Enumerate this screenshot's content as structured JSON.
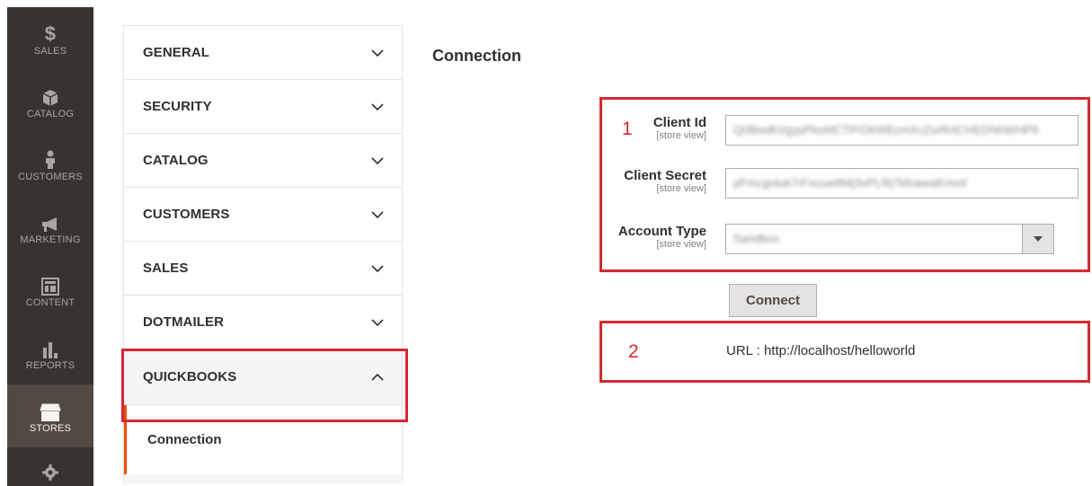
{
  "admin_nav": [
    {
      "label": "SALES",
      "icon": "dollar-icon"
    },
    {
      "label": "CATALOG",
      "icon": "box-icon"
    },
    {
      "label": "CUSTOMERS",
      "icon": "person-icon"
    },
    {
      "label": "MARKETING",
      "icon": "megaphone-icon"
    },
    {
      "label": "CONTENT",
      "icon": "layout-icon"
    },
    {
      "label": "REPORTS",
      "icon": "bar-chart-icon"
    },
    {
      "label": "STORES",
      "icon": "store-icon",
      "active": true
    }
  ],
  "tabs": [
    {
      "label": "GENERAL"
    },
    {
      "label": "SECURITY"
    },
    {
      "label": "CATALOG"
    },
    {
      "label": "CUSTOMERS"
    },
    {
      "label": "SALES"
    },
    {
      "label": "DOTMAILER"
    },
    {
      "label": "QUICKBOOKS",
      "expanded": true
    }
  ],
  "subtab": {
    "label": "Connection"
  },
  "section": {
    "title": "Connection"
  },
  "fields": {
    "client_id": {
      "label": "Client Id",
      "scope": "[store view]",
      "value": "Q0BwdkVgypPkoMCTPrDkWEcmXcZorRrtCHEDNhWHP9"
    },
    "client_secret": {
      "label": "Client Secret",
      "scope": "[store view]",
      "value": "pFmcgotuk7rFscuw8Mj3oPLRj7bfoawaKmvd"
    },
    "account_type": {
      "label": "Account Type",
      "scope": "[store view]",
      "value": "Sandbox"
    }
  },
  "connect_button": {
    "label": "Connect"
  },
  "url": {
    "text": "URL : http://localhost/helloworld"
  },
  "annotations": {
    "box1": "1",
    "box2": "2"
  },
  "colors": {
    "accent": "#eb5202",
    "annotation": "#d42a34",
    "sidebar": "#373330"
  }
}
